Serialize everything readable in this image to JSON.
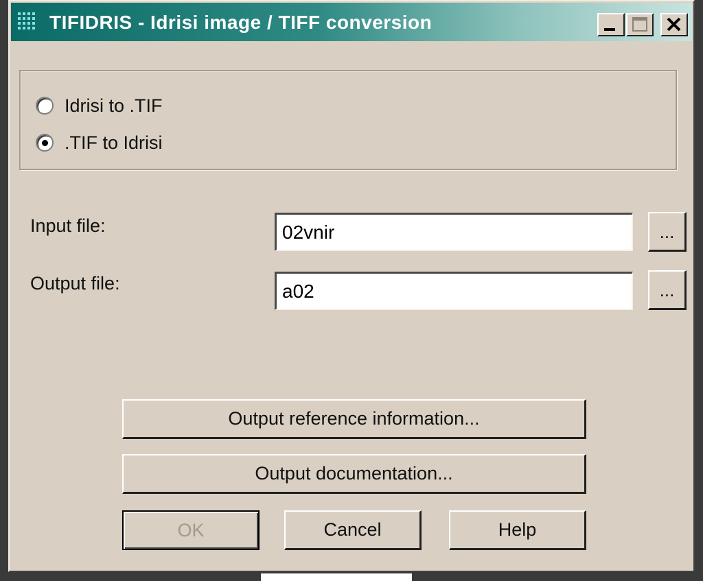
{
  "window": {
    "title": "TIFIDRIS - Idrisi image / TIFF conversion",
    "app_icon": "grid-icon",
    "caption_buttons": [
      "minimize-icon",
      "maximize-icon",
      "close-icon"
    ]
  },
  "conversion": {
    "options": [
      {
        "label": "Idrisi to .TIF",
        "selected": false
      },
      {
        "label": ".TIF to Idrisi",
        "selected": true
      }
    ]
  },
  "files": {
    "input_label": "Input file:",
    "input_value": "02vnir",
    "output_label": "Output file:",
    "output_value": "a02",
    "browse_label": "..."
  },
  "buttons": {
    "reference": "Output reference information...",
    "documentation": "Output documentation...",
    "ok": "OK",
    "cancel": "Cancel",
    "help": "Help"
  },
  "colors": {
    "titlebar_start": "#0b6b66",
    "titlebar_end": "#c9e3df",
    "face": "#d9d0c3"
  }
}
